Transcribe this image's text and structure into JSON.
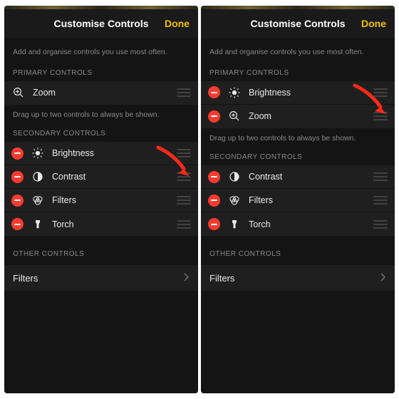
{
  "colors": {
    "accent": "#f2c200",
    "danger": "#ff3b30",
    "bg": "#141414"
  },
  "left": {
    "title": "Customise Controls",
    "done": "Done",
    "hint": "Add and organise controls you use most often.",
    "primary_header": "PRIMARY CONTROLS",
    "primary": [
      {
        "icon": "zoom",
        "label": "Zoom"
      }
    ],
    "primary_note": "Drag up to two controls to always be shown.",
    "secondary_header": "SECONDARY CONTROLS",
    "secondary": [
      {
        "icon": "brightness",
        "label": "Brightness"
      },
      {
        "icon": "contrast",
        "label": "Contrast"
      },
      {
        "icon": "filters",
        "label": "Filters"
      },
      {
        "icon": "torch",
        "label": "Torch"
      }
    ],
    "other_header": "OTHER CONTROLS",
    "other": [
      {
        "label": "Filters"
      }
    ]
  },
  "right": {
    "title": "Customise Controls",
    "done": "Done",
    "hint": "Add and organise controls you use most often.",
    "primary_header": "PRIMARY CONTROLS",
    "primary": [
      {
        "icon": "brightness",
        "label": "Brightness"
      },
      {
        "icon": "zoom",
        "label": "Zoom"
      }
    ],
    "primary_note": "Drag up to two controls to always be shown.",
    "secondary_header": "SECONDARY CONTROLS",
    "secondary": [
      {
        "icon": "contrast",
        "label": "Contrast"
      },
      {
        "icon": "filters",
        "label": "Filters"
      },
      {
        "icon": "torch",
        "label": "Torch"
      }
    ],
    "other_header": "OTHER CONTROLS",
    "other": [
      {
        "label": "Filters"
      }
    ]
  }
}
